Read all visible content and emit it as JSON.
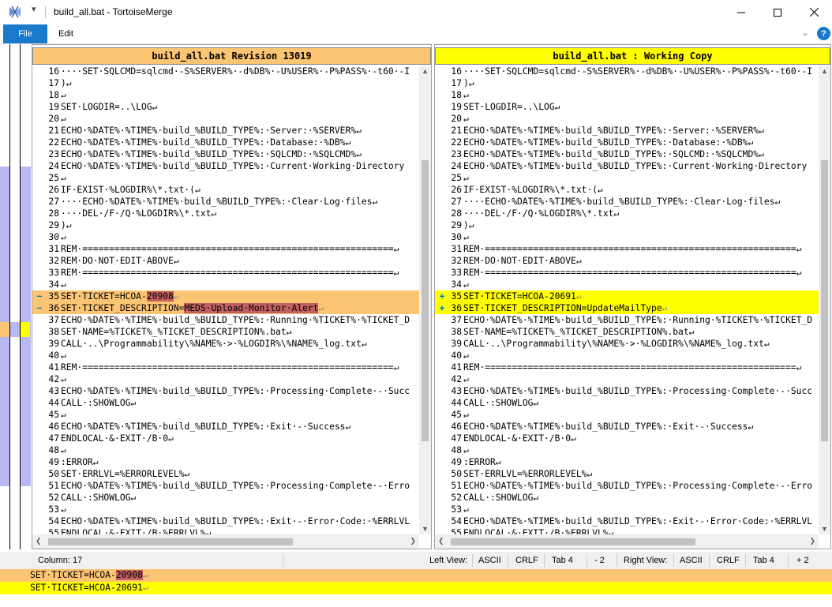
{
  "window": {
    "title": "build_all.bat - TortoiseMerge",
    "qat_label": "▾"
  },
  "menu": {
    "file": "File",
    "edit": "Edit",
    "chevron": "⌄",
    "help": "?"
  },
  "colors": {
    "left_header": "#fcc573",
    "right_header": "#ffff00",
    "removed_line": "#fcc573",
    "added_line": "#ffff00",
    "removed_word": "#c26060",
    "locator_block": "#b8b8f5"
  },
  "left_pane": {
    "header": "build_all.bat Revision 13019",
    "lines": [
      {
        "n": "16",
        "t": "····SET·SQLCMD=sqlcmd·-S%SERVER%·-d%DB%·-U%USER%·-P%PASS%·-t60·-I"
      },
      {
        "n": "17",
        "t": ")↵"
      },
      {
        "n": "18",
        "t": "↵"
      },
      {
        "n": "19",
        "t": "SET·LOGDIR=..\\LOG↵"
      },
      {
        "n": "20",
        "t": "↵"
      },
      {
        "n": "21",
        "t": "ECHO·%DATE%·%TIME%·build_%BUILD_TYPE%:·Server:·%SERVER%↵"
      },
      {
        "n": "22",
        "t": "ECHO·%DATE%·%TIME%·build_%BUILD_TYPE%:·Database:·%DB%↵"
      },
      {
        "n": "23",
        "t": "ECHO·%DATE%·%TIME%·build_%BUILD_TYPE%:·SQLCMD:·%SQLCMD%↵"
      },
      {
        "n": "24",
        "t": "ECHO·%DATE%·%TIME%·build_%BUILD_TYPE%:·Current·Working·Directory"
      },
      {
        "n": "25",
        "t": "↵"
      },
      {
        "n": "26",
        "t": "IF·EXIST·%LOGDIR%\\*.txt·(↵"
      },
      {
        "n": "27",
        "t": "····ECHO·%DATE%·%TIME%·build_%BUILD_TYPE%:·Clear·Log·files↵"
      },
      {
        "n": "28",
        "t": "····DEL·/F·/Q·%LOGDIR%\\*.txt↵"
      },
      {
        "n": "29",
        "t": ")↵"
      },
      {
        "n": "30",
        "t": "↵"
      },
      {
        "n": "31",
        "t": "REM·==========================================================↵"
      },
      {
        "n": "32",
        "t": "REM·DO·NOT·EDIT·ABOVE↵"
      },
      {
        "n": "33",
        "t": "REM·==========================================================↵"
      },
      {
        "n": "34",
        "t": "↵"
      },
      {
        "n": "35",
        "g": "−",
        "kind": "removed",
        "t": "SET·TICKET=HCOA-",
        "hl": "20908",
        "tail": "↵"
      },
      {
        "n": "36",
        "g": "−",
        "kind": "removed",
        "t": "SET·TICKET_DESCRIPTION=",
        "hl": "MEDS·Upload·Monitor·Alert",
        "tail": "↵"
      },
      {
        "n": "37",
        "t": "ECHO·%DATE%·%TIME%·build_%BUILD_TYPE%:·Running·%TICKET%·%TICKET_D"
      },
      {
        "n": "38",
        "t": "SET·NAME=%TICKET%_%TICKET_DESCRIPTION%.bat↵"
      },
      {
        "n": "39",
        "t": "CALL·..\\Programmability\\%NAME%·>·%LOGDIR%\\%NAME%_log.txt↵"
      },
      {
        "n": "40",
        "t": "↵"
      },
      {
        "n": "41",
        "t": "REM·==========================================================↵"
      },
      {
        "n": "42",
        "t": "↵"
      },
      {
        "n": "43",
        "t": "ECHO·%DATE%·%TIME%·build_%BUILD_TYPE%:·Processing·Complete·-·Succ"
      },
      {
        "n": "44",
        "t": "CALL·:SHOWLOG↵"
      },
      {
        "n": "45",
        "t": "↵"
      },
      {
        "n": "46",
        "t": "ECHO·%DATE%·%TIME%·build_%BUILD_TYPE%:·Exit·-·Success↵"
      },
      {
        "n": "47",
        "t": "ENDLOCAL·&·EXIT·/B·0↵"
      },
      {
        "n": "48",
        "t": "↵"
      },
      {
        "n": "49",
        "t": ":ERROR↵"
      },
      {
        "n": "50",
        "t": "SET·ERRLVL=%ERRORLEVEL%↵"
      },
      {
        "n": "51",
        "t": "ECHO·%DATE%·%TIME%·build_%BUILD_TYPE%:·Processing·Complete·-·Erro"
      },
      {
        "n": "52",
        "t": "CALL·:SHOWLOG↵"
      },
      {
        "n": "53",
        "t": "↵"
      },
      {
        "n": "54",
        "t": "ECHO·%DATE%·%TIME%·build_%BUILD_TYPE%:·Exit·-·Error·Code:·%ERRLVL"
      },
      {
        "n": "55",
        "t": "ENDLOCAL·&·EXIT·/B·%ERRLVL%↵"
      }
    ]
  },
  "right_pane": {
    "header": "build_all.bat : Working Copy",
    "lines": [
      {
        "n": "16",
        "t": "····SET·SQLCMD=sqlcmd·-S%SERVER%·-d%DB%·-U%USER%·-P%PASS%·-t60·-I"
      },
      {
        "n": "17",
        "t": ")↵"
      },
      {
        "n": "18",
        "t": "↵"
      },
      {
        "n": "19",
        "t": "SET·LOGDIR=..\\LOG↵"
      },
      {
        "n": "20",
        "t": "↵"
      },
      {
        "n": "21",
        "t": "ECHO·%DATE%·%TIME%·build_%BUILD_TYPE%:·Server:·%SERVER%↵"
      },
      {
        "n": "22",
        "t": "ECHO·%DATE%·%TIME%·build_%BUILD_TYPE%:·Database:·%DB%↵"
      },
      {
        "n": "23",
        "t": "ECHO·%DATE%·%TIME%·build_%BUILD_TYPE%:·SQLCMD:·%SQLCMD%↵"
      },
      {
        "n": "24",
        "t": "ECHO·%DATE%·%TIME%·build_%BUILD_TYPE%:·Current·Working·Directory"
      },
      {
        "n": "25",
        "t": "↵"
      },
      {
        "n": "26",
        "t": "IF·EXIST·%LOGDIR%\\*.txt·(↵"
      },
      {
        "n": "27",
        "t": "····ECHO·%DATE%·%TIME%·build_%BUILD_TYPE%:·Clear·Log·files↵"
      },
      {
        "n": "28",
        "t": "····DEL·/F·/Q·%LOGDIR%\\*.txt↵"
      },
      {
        "n": "29",
        "t": ")↵"
      },
      {
        "n": "30",
        "t": "↵"
      },
      {
        "n": "31",
        "t": "REM·==========================================================↵"
      },
      {
        "n": "32",
        "t": "REM·DO·NOT·EDIT·ABOVE↵"
      },
      {
        "n": "33",
        "t": "REM·==========================================================↵"
      },
      {
        "n": "34",
        "t": "↵"
      },
      {
        "n": "35",
        "g": "+",
        "kind": "added",
        "t": "SET·TICKET=HCOA-",
        "hl": "20691",
        "tail": "↵"
      },
      {
        "n": "36",
        "g": "+",
        "kind": "added",
        "t": "SET·TICKET_DESCRIPTION=",
        "hl": "UpdateMailType",
        "tail": "↵"
      },
      {
        "n": "37",
        "t": "ECHO·%DATE%·%TIME%·build_%BUILD_TYPE%:·Running·%TICKET%·%TICKET_D"
      },
      {
        "n": "38",
        "t": "SET·NAME=%TICKET%_%TICKET_DESCRIPTION%.bat↵"
      },
      {
        "n": "39",
        "t": "CALL·..\\Programmability\\%NAME%·>·%LOGDIR%\\%NAME%_log.txt↵"
      },
      {
        "n": "40",
        "t": "↵"
      },
      {
        "n": "41",
        "t": "REM·==========================================================↵"
      },
      {
        "n": "42",
        "t": "↵"
      },
      {
        "n": "43",
        "t": "ECHO·%DATE%·%TIME%·build_%BUILD_TYPE%:·Processing·Complete·-·Succ"
      },
      {
        "n": "44",
        "t": "CALL·:SHOWLOG↵"
      },
      {
        "n": "45",
        "t": "↵"
      },
      {
        "n": "46",
        "t": "ECHO·%DATE%·%TIME%·build_%BUILD_TYPE%:·Exit·-·Success↵"
      },
      {
        "n": "47",
        "t": "ENDLOCAL·&·EXIT·/B·0↵"
      },
      {
        "n": "48",
        "t": "↵"
      },
      {
        "n": "49",
        "t": ":ERROR↵"
      },
      {
        "n": "50",
        "t": "SET·ERRLVL=%ERRORLEVEL%↵"
      },
      {
        "n": "51",
        "t": "ECHO·%DATE%·%TIME%·build_%BUILD_TYPE%:·Processing·Complete·-·Erro"
      },
      {
        "n": "52",
        "t": "CALL·:SHOWLOG↵"
      },
      {
        "n": "53",
        "t": "↵"
      },
      {
        "n": "54",
        "t": "ECHO·%DATE%·%TIME%·build_%BUILD_TYPE%:·Exit·-·Error·Code:·%ERRLVL"
      },
      {
        "n": "55",
        "t": "ENDLOCAL·&·EXIT·/B·%ERRLVL%↵"
      }
    ]
  },
  "status": {
    "column": "Column: 17",
    "left_view_label": "Left View:",
    "left_encoding": "ASCII",
    "left_eol": "CRLF",
    "left_tab": "Tab 4",
    "left_diff": "- 2",
    "right_view_label": "Right View:",
    "right_encoding": "ASCII",
    "right_eol": "CRLF",
    "right_tab": "Tab 4",
    "right_diff": "+ 2"
  },
  "bottom_view": {
    "left": {
      "prefix": "SET·TICKET=HCOA-",
      "hl": "20908",
      "tail": "↵"
    },
    "right": {
      "prefix": "SET·TICKET=HCOA-",
      "hl": "20691",
      "tail": "↵"
    }
  }
}
